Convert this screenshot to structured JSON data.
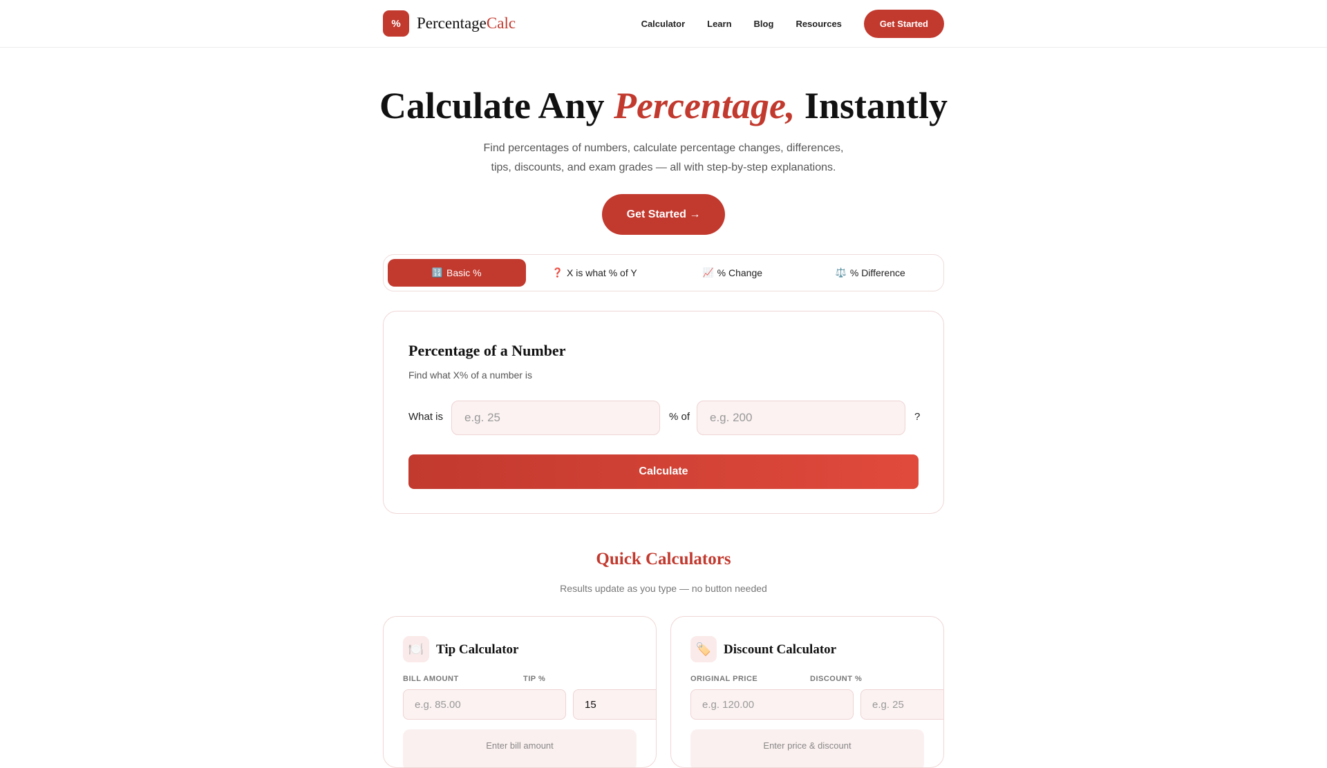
{
  "brand": {
    "badge": "%",
    "name_main": "Percentage",
    "name_accent": "Calc",
    "color": "#c2392e"
  },
  "nav": {
    "links": [
      "Calculator",
      "Learn",
      "Blog",
      "Resources"
    ],
    "cta": "Get Started"
  },
  "hero": {
    "title_before": "Calculate Any ",
    "title_em": "Percentage,",
    "title_after": " Instantly",
    "subtitle_line1": "Find percentages of numbers, calculate percentage changes, differences,",
    "subtitle_line2": "tips, discounts, and exam grades — all with step-by-step explanations.",
    "cta": "Get Started →"
  },
  "tabs": [
    {
      "icon": "🔢",
      "label": "Basic %",
      "active": true
    },
    {
      "icon": "❓",
      "label": "X is what % of Y",
      "active": false
    },
    {
      "icon": "📈",
      "label": "% Change",
      "active": false
    },
    {
      "icon": "⚖️",
      "label": "% Difference",
      "active": false
    }
  ],
  "calculator": {
    "title": "Percentage of a Number",
    "description": "Find what X% of a number is",
    "label_what_is": "What is",
    "percent_placeholder": "e.g. 25",
    "label_percent_of": "% of",
    "number_placeholder": "e.g. 200",
    "label_question": "?",
    "button": "Calculate"
  },
  "quick": {
    "title": "Quick Calculators",
    "subtitle": "Results update as you type — no button needed",
    "tip": {
      "icon": "🍽️",
      "title": "Tip Calculator",
      "bill_label": "BILL AMOUNT",
      "tip_label": "TIP %",
      "bill_placeholder": "e.g. 85.00",
      "tip_value": "15",
      "result": "Enter bill amount"
    },
    "discount": {
      "icon": "🏷️",
      "title": "Discount Calculator",
      "price_label": "ORIGINAL PRICE",
      "discount_label": "DISCOUNT %",
      "price_placeholder": "e.g. 120.00",
      "discount_placeholder": "e.g. 25",
      "result": "Enter price & discount"
    }
  }
}
